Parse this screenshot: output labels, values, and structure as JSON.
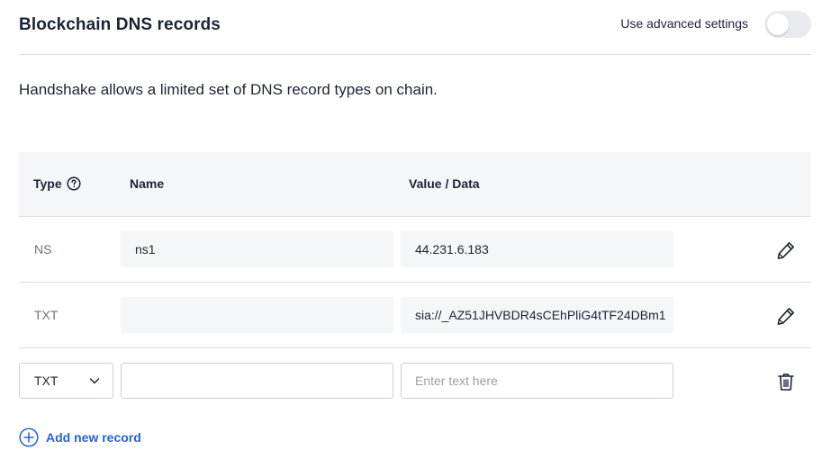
{
  "header": {
    "title": "Blockchain DNS records",
    "advanced_label": "Use advanced settings",
    "advanced_enabled": false
  },
  "description": "Handshake allows a limited set of DNS record types on chain.",
  "table": {
    "columns": {
      "type": "Type",
      "name": "Name",
      "value": "Value / Data"
    },
    "rows": [
      {
        "type": "NS",
        "name": "ns1",
        "value": "44.231.6.183"
      },
      {
        "type": "TXT",
        "name": "",
        "value": "sia://_AZ51JHVBDR4sCEhPliG4tTF24DBm1"
      }
    ],
    "new_row": {
      "type": "TXT",
      "name": "",
      "value_placeholder": "Enter text here"
    }
  },
  "add_record_label": "Add new record",
  "colors": {
    "accent": "#2563d9",
    "header_bg": "#f5f6f8",
    "border": "#dcdfe4"
  },
  "icons": {
    "help": "help-circle-icon",
    "edit": "pencil-icon",
    "delete": "trash-icon",
    "add": "plus-circle-icon",
    "dropdown": "chevron-down-icon"
  }
}
